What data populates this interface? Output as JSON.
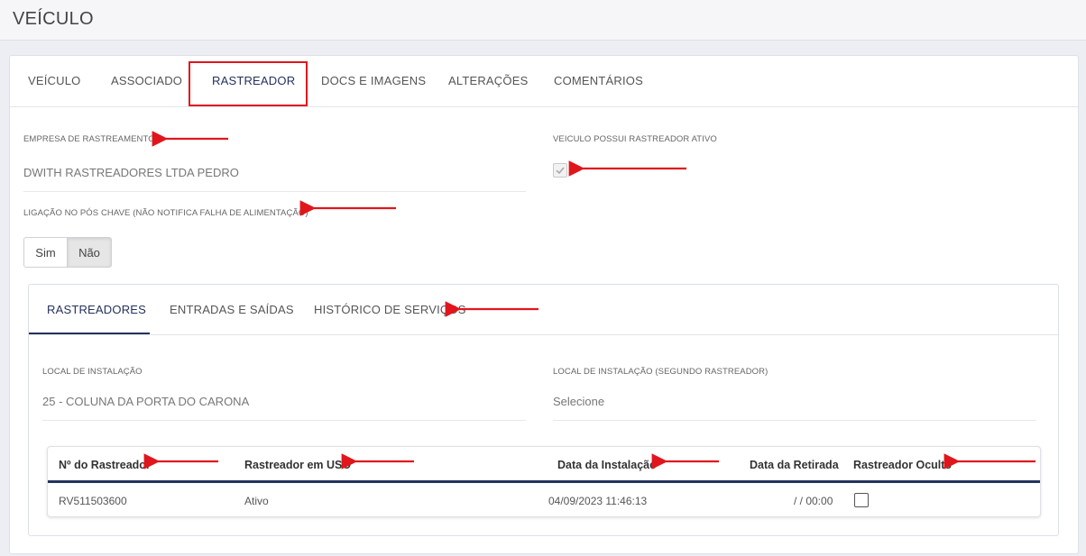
{
  "header": {
    "title": "VEÍCULO"
  },
  "main_tabs": [
    {
      "label": "VEÍCULO"
    },
    {
      "label": "ASSOCIADO"
    },
    {
      "label": "RASTREADOR"
    },
    {
      "label": "DOCS E IMAGENS"
    },
    {
      "label": "ALTERAÇÕES"
    },
    {
      "label": "COMENTÁRIOS"
    }
  ],
  "active_main_tab": "RASTREADOR",
  "fields": {
    "empresa_label": "EMPRESA DE RASTREAMENTO",
    "empresa_value": "DWITH RASTREADORES LTDA PEDRO",
    "rastreador_ativo_label": "VEICULO POSSUI RASTREADOR ATIVO",
    "rastreador_ativo_checked": true,
    "ligacao_label": "LIGAÇÃO NO PÓS CHAVE (NÃO NOTIFICA FALHA DE ALIMENTAÇÃO)",
    "ligacao_options": [
      "Sim",
      "Não"
    ],
    "ligacao_selected": "Não"
  },
  "sub_tabs": [
    {
      "label": "RASTREADORES"
    },
    {
      "label": "ENTRADAS E SAÍDAS"
    },
    {
      "label": "HISTÓRICO DE SERVIÇOS"
    }
  ],
  "active_sub_tab": "RASTREADORES",
  "install": {
    "local_label": "LOCAL DE INSTALAÇÃO",
    "local_value": "25 - COLUNA DA PORTA DO CARONA",
    "local2_label": "LOCAL DE INSTALAÇÃO (SEGUNDO RASTREADOR)",
    "local2_value": "Selecione"
  },
  "table": {
    "headers": [
      "Nº do Rastreador",
      "Rastreador em USO",
      "Data da Instalação",
      "Data da Retirada",
      "Rastreador Oculto"
    ],
    "rows": [
      [
        "RV511503600",
        "Ativo",
        "04/09/2023 11:46:13",
        "/ / 00:00",
        false
      ]
    ]
  },
  "colors": {
    "accent": "#24325e",
    "highlight": "#e0161c"
  },
  "icons": {
    "checkbox_checked": "check-icon",
    "annotation": "red-arrow-icon"
  }
}
